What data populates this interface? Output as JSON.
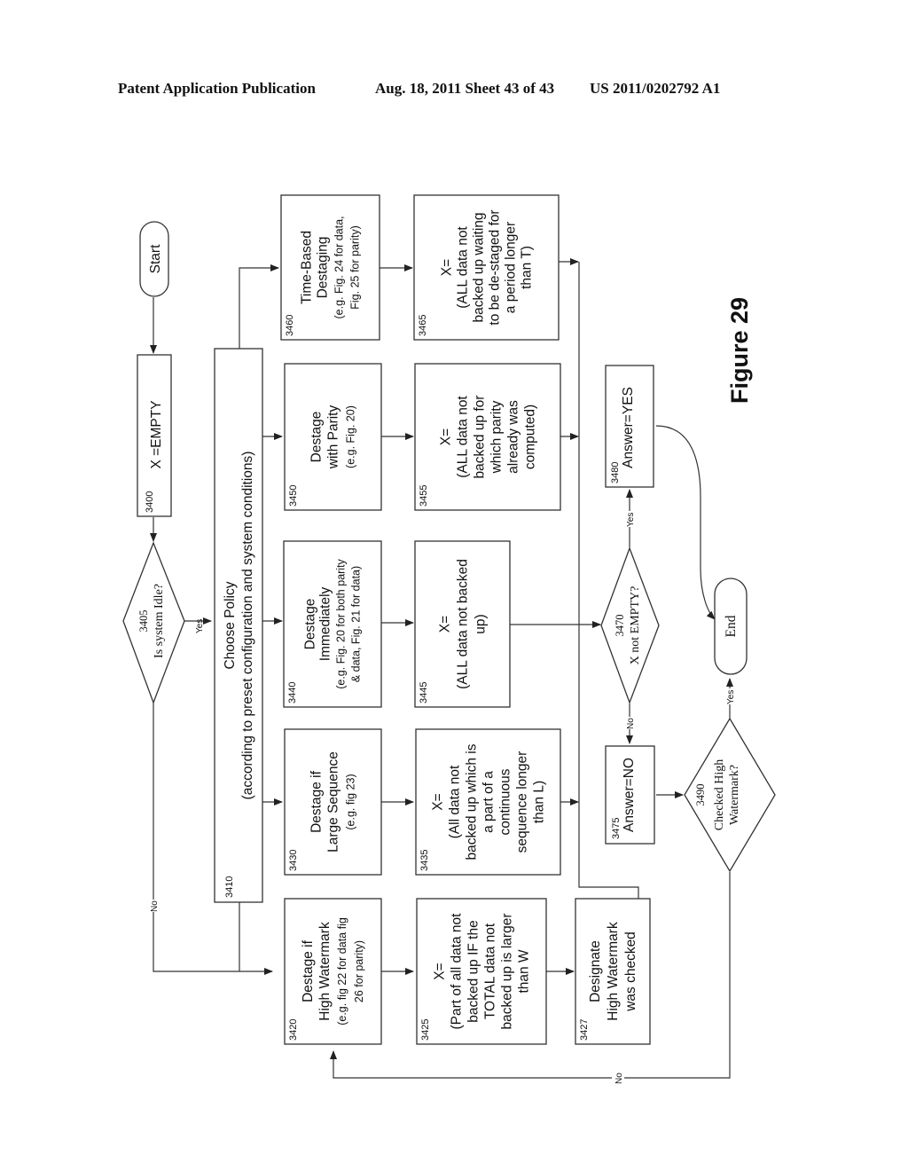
{
  "header": {
    "left": "Patent Application Publication",
    "middle": "Aug. 18, 2011  Sheet 43 of 43",
    "right": "US 2011/0202792 A1"
  },
  "figure_label": "Figure 29",
  "nodes": {
    "start": {
      "text": "Start"
    },
    "end": {
      "text": "End"
    },
    "n3400": {
      "id": "3400",
      "lines": [
        "X =EMPTY"
      ]
    },
    "n3405": {
      "id": "3405",
      "lines": [
        "Is system Idle?"
      ]
    },
    "n3410": {
      "id": "3410",
      "lines": [
        "Choose Policy",
        "(according to preset configuration and system conditions)"
      ]
    },
    "n3420": {
      "id": "3420",
      "lines": [
        "Destage if",
        "High Watermark",
        "(e.g. fig 22 for data fig",
        "26 for parity)"
      ]
    },
    "n3425": {
      "id": "3425",
      "lines": [
        "X=",
        "(Part of all data not",
        "backed up IF the",
        "TOTAL data not",
        "backed up is larger",
        "than W"
      ]
    },
    "n3427": {
      "id": "3427",
      "lines": [
        "Designate",
        "High Watermark",
        "was checked"
      ]
    },
    "n3430": {
      "id": "3430",
      "lines": [
        "Destage if",
        "Large Sequence",
        "(e.g. fig 23)"
      ]
    },
    "n3435": {
      "id": "3435",
      "lines": [
        "X=",
        "(All data not",
        "backed up which is",
        "a part of a",
        "continuous",
        "sequence longer",
        "than L)"
      ]
    },
    "n3440": {
      "id": "3440",
      "lines": [
        "Destage",
        "Immediately",
        "(e.g. Fig. 20 for both parity",
        "& data, Fig. 21 for data)"
      ]
    },
    "n3445": {
      "id": "3445",
      "lines": [
        "X=",
        "(ALL data not backed",
        "up)"
      ]
    },
    "n3450": {
      "id": "3450",
      "lines": [
        "Destage",
        "with Parity",
        "(e.g. Fig. 20)"
      ]
    },
    "n3455": {
      "id": "3455",
      "lines": [
        "X=",
        "(ALL data not",
        "backed up for",
        "which parity",
        "already  was",
        "computed)"
      ]
    },
    "n3460": {
      "id": "3460",
      "lines": [
        "Time-Based",
        "Destaging",
        "(e.g. Fig. 24 for data,",
        "Fig. 25 for parity)"
      ]
    },
    "n3465": {
      "id": "3465",
      "lines": [
        "X=",
        "(ALL data not",
        "backed up  waiting",
        "to be de-staged for",
        "a period longer",
        "than T)"
      ]
    },
    "n3470": {
      "id": "3470",
      "lines": [
        "X not EMPTY?"
      ]
    },
    "n3475": {
      "id": "3475",
      "lines": [
        "Answer=NO"
      ]
    },
    "n3480": {
      "id": "3480",
      "lines": [
        "Answer=YES"
      ]
    },
    "n3490": {
      "id": "3490",
      "lines": [
        "Checked High",
        "Watermark?"
      ]
    }
  },
  "edge_labels": {
    "idle_yes": "Yes",
    "idle_no": "No",
    "notempty_yes": "Yes",
    "notempty_no": "No",
    "checked_yes": "Yes",
    "checked_no": "No"
  }
}
